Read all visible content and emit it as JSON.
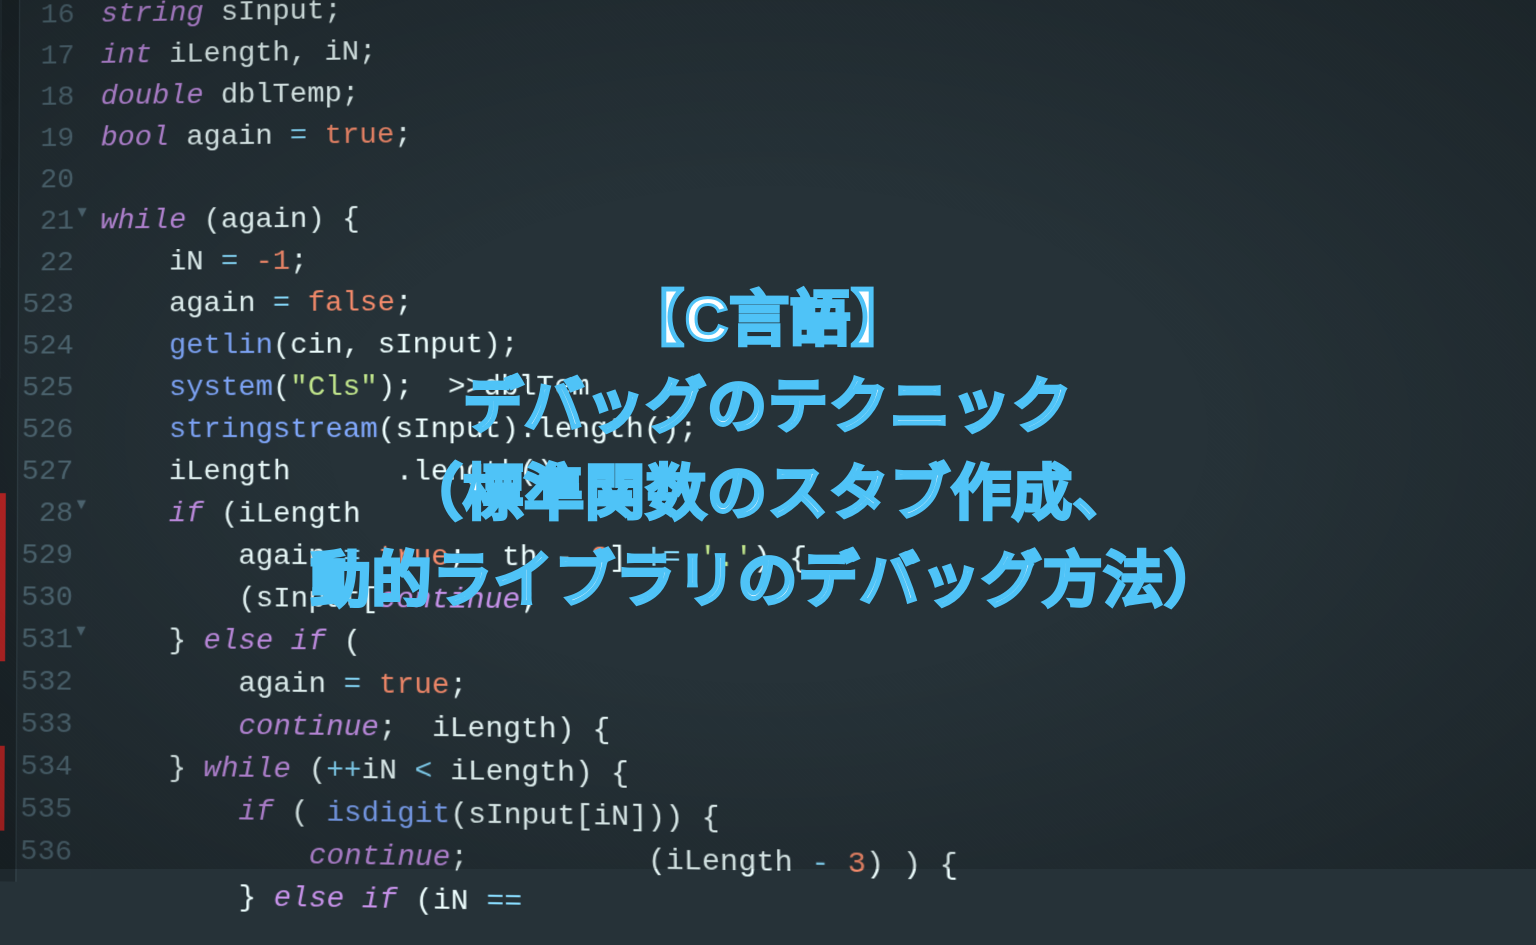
{
  "line_numbers": [
    "16",
    "17",
    "18",
    "19",
    "20",
    "21",
    "22",
    "523",
    "524",
    "525",
    "526",
    "527",
    "28",
    "529",
    "530",
    "531",
    "532",
    "533",
    "534",
    "535",
    "536"
  ],
  "code": {
    "l16": {
      "indent": "        ",
      "type": "string",
      "ident": "sInput"
    },
    "l17": {
      "indent": "        ",
      "type": "int",
      "ident": "iLength, iN"
    },
    "l18": {
      "indent": "        ",
      "type": "double",
      "ident": "dblTemp"
    },
    "l19": {
      "indent": "        ",
      "type": "bool",
      "ident": "again",
      "val": "true"
    },
    "l21": {
      "indent": "        ",
      "kw": "while",
      "cond": "again"
    },
    "l22": {
      "indent": "            ",
      "ident": "iN",
      "val": "-1"
    },
    "l23": {
      "indent": "            ",
      "ident": "again",
      "val": "false"
    },
    "l24": {
      "indent": "            ",
      "func": "getlin",
      "arg": "sInput"
    },
    "l25": {
      "indent": "            ",
      "func": "system",
      "arg": "\"Cls\""
    },
    "l26": {
      "indent": "            ",
      "func": "stringstream",
      "arg": "sInput",
      "suffix": ".length();"
    },
    "l27": {
      "indent": "            ",
      "ident": "iLe",
      "rest": "ngth"
    },
    "l28": {
      "indent": "            ",
      "kw": "if",
      "cond": "iLeng",
      "rest": "th"
    },
    "l29": {
      "indent": "                ",
      "ident": "again",
      "val": "true",
      "tail": "3] != '.') {"
    },
    "l30": {
      "indent": "                ",
      "text": "(sInput[",
      "kw": "continue"
    },
    "l31": {
      "indent": "            ",
      "kw": "else if",
      "cond": ""
    },
    "l32": {
      "indent": "                ",
      "ident": "again",
      "val": "true"
    },
    "l33": {
      "indent": "                ",
      "kw": "continue",
      "tail": "iLength) {"
    },
    "l34": {
      "indent": "            ",
      "kw": "while",
      "cond": "++iN < iLength",
      "func": "isdigit",
      "arg": "sInput[iN]"
    },
    "l35": {
      "indent": "                ",
      "kw": "if",
      "cond": "iN == (iLength - 3)",
      "tail": ") ) {"
    },
    "l36": {
      "indent": "                    ",
      "kw": "continue"
    },
    "l37": {
      "indent": "                ",
      "kw": "else if"
    }
  },
  "title": {
    "line1": "【C言語】",
    "line2": "デバッグのテクニック",
    "line3": "（標準関数のスタブ作成、",
    "line4": "動的ライブラリのデバッグ方法）"
  }
}
